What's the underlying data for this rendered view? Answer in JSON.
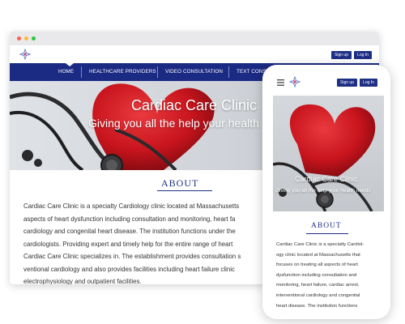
{
  "desktop": {
    "header": {
      "signup_label": "Sign up",
      "login_label": "Log In"
    },
    "nav": {
      "items": [
        {
          "label": "HOME",
          "active": true
        },
        {
          "label": "HEALTHCARE PROVIDERS"
        },
        {
          "label": "VIDEO CONSULTATION"
        },
        {
          "label": "TEXT CONSI"
        }
      ]
    },
    "hero": {
      "title": "Cardiac Care Clinic",
      "subtitle": "Giving you all the help your health"
    },
    "about": {
      "heading": "ABOUT",
      "lines": [
        "Cardiac Care Clinic is a specialty Cardiology clinic located at Massachusetts",
        "aspects of heart dysfunction including consultation and monitoring, heart fa",
        "cardiology and congenital heart disease. The institution functions under the",
        "cardiologists. Providing expert and timely help for the entire range of heart",
        "Cardiac Care Clinic specializes in. The establishment provides consultation s",
        "ventional cardiology and also provides facilities including heart failure clinic",
        "electrophysiology and outpatient facilities."
      ]
    }
  },
  "mobile": {
    "header": {
      "signup_label": "Sign up",
      "login_label": "Log In"
    },
    "hero": {
      "title": "Cardiac Care Clinic",
      "subtitle": "Giving you all the help your health needs"
    },
    "about": {
      "heading": "ABOUT",
      "lines": [
        "Cardiac Care Clinic is a specialty Cardiol-",
        "ogy clinic located at Massachusetts that",
        "focuses on treating all aspects of heart",
        "dysfunction including consultation and",
        "monitoring, heart failure, cardiac arrest,",
        "interventional cardiology and congenital",
        "heart disease. The institution functions"
      ]
    }
  },
  "colors": {
    "brand_navy": "#1b2a83",
    "button_navy": "#1e2f86",
    "heart_red": "#c8141d"
  }
}
